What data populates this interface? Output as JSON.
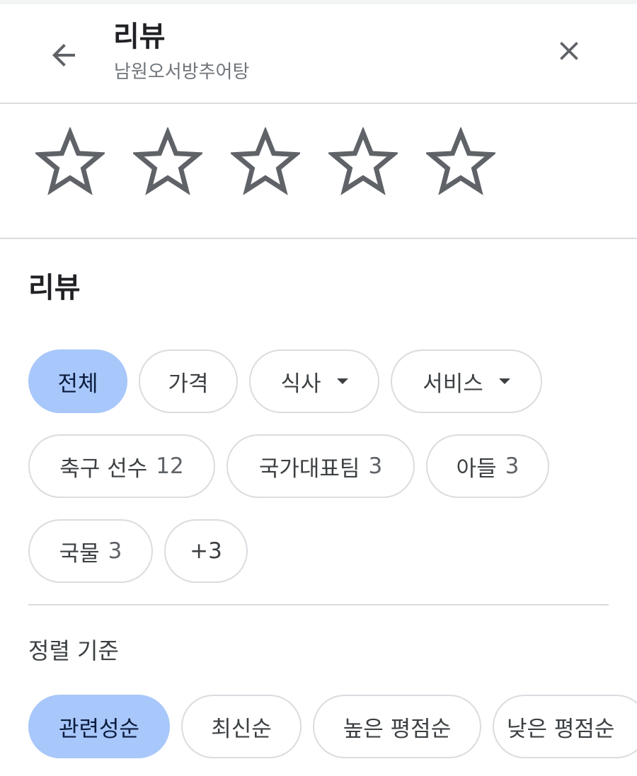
{
  "header": {
    "title": "리뷰",
    "subtitle": "남원오서방추어탕"
  },
  "rating": {
    "max_stars": 5,
    "selected": 0
  },
  "reviews_section": {
    "title": "리뷰",
    "filters": [
      {
        "label": "전체",
        "selected": true
      },
      {
        "label": "가격"
      },
      {
        "label": "식사",
        "dropdown": true
      },
      {
        "label": "서비스",
        "dropdown": true
      }
    ],
    "topics": [
      {
        "label": "축구 선수",
        "count": "12"
      },
      {
        "label": "국가대표팀",
        "count": "3"
      },
      {
        "label": "아들",
        "count": "3"
      },
      {
        "label": "국물",
        "count": "3"
      },
      {
        "label": "+3"
      }
    ]
  },
  "sort": {
    "label": "정렬 기준",
    "options": [
      {
        "label": "관련성순",
        "selected": true
      },
      {
        "label": "최신순"
      },
      {
        "label": "높은 평점순"
      },
      {
        "label": "낮은 평점순"
      }
    ]
  },
  "colors": {
    "selected_chip": "#a8c7fa",
    "divider": "#dadce0",
    "star_outline": "#5f6368"
  }
}
